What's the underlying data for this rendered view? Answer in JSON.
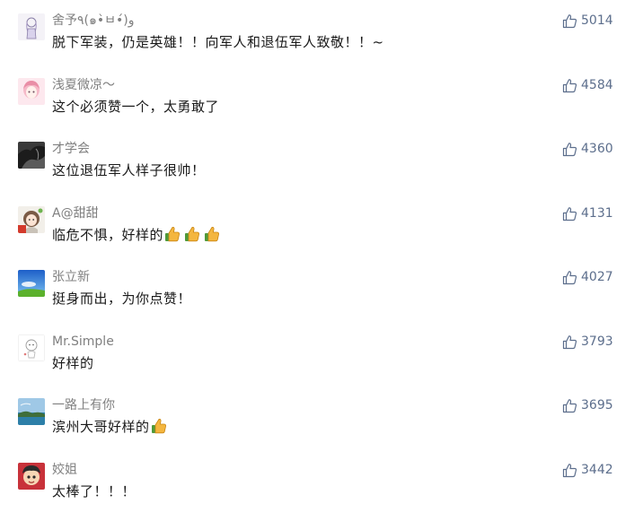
{
  "comments": [
    {
      "username": "舍予٩(๑•̀ㅂ•́)و",
      "text": "脱下军装，仍是英雄！！向军人和退伍军人致敬！！~",
      "likes": "5014",
      "avatar": "sketch-girl-avatar"
    },
    {
      "username": "浅夏微凉～",
      "text": "这个必须赞一个，太勇敢了",
      "likes": "4584",
      "avatar": "anime-girl-avatar"
    },
    {
      "username": "才学会",
      "text": "这位退伍军人样子很帅！",
      "likes": "4360",
      "avatar": "dark-rock-avatar"
    },
    {
      "username": "A@甜甜",
      "text": "临危不惧，好样的",
      "likes": "4131",
      "avatar": "doll-girl-avatar",
      "emojis": 3
    },
    {
      "username": "张立新",
      "text": "挺身而出，为你点赞！",
      "likes": "4027",
      "avatar": "blue-sky-avatar"
    },
    {
      "username": "Mr.Simple",
      "text": "好样的",
      "likes": "3793",
      "avatar": "white-doodle-avatar"
    },
    {
      "username": "一路上有你",
      "text": "滨州大哥好样的",
      "likes": "3695",
      "avatar": "seaside-avatar",
      "emojis": 1
    },
    {
      "username": "姣姐",
      "text": "太棒了！！！",
      "likes": "3442",
      "avatar": "red-cartoon-avatar"
    }
  ],
  "icons": {
    "like": "thumbs-up-outline-icon",
    "emoji": "thumbs-up-emoji"
  },
  "colors": {
    "username": "#808080",
    "text": "#1a1a1a",
    "like": "#5c6e8c"
  }
}
